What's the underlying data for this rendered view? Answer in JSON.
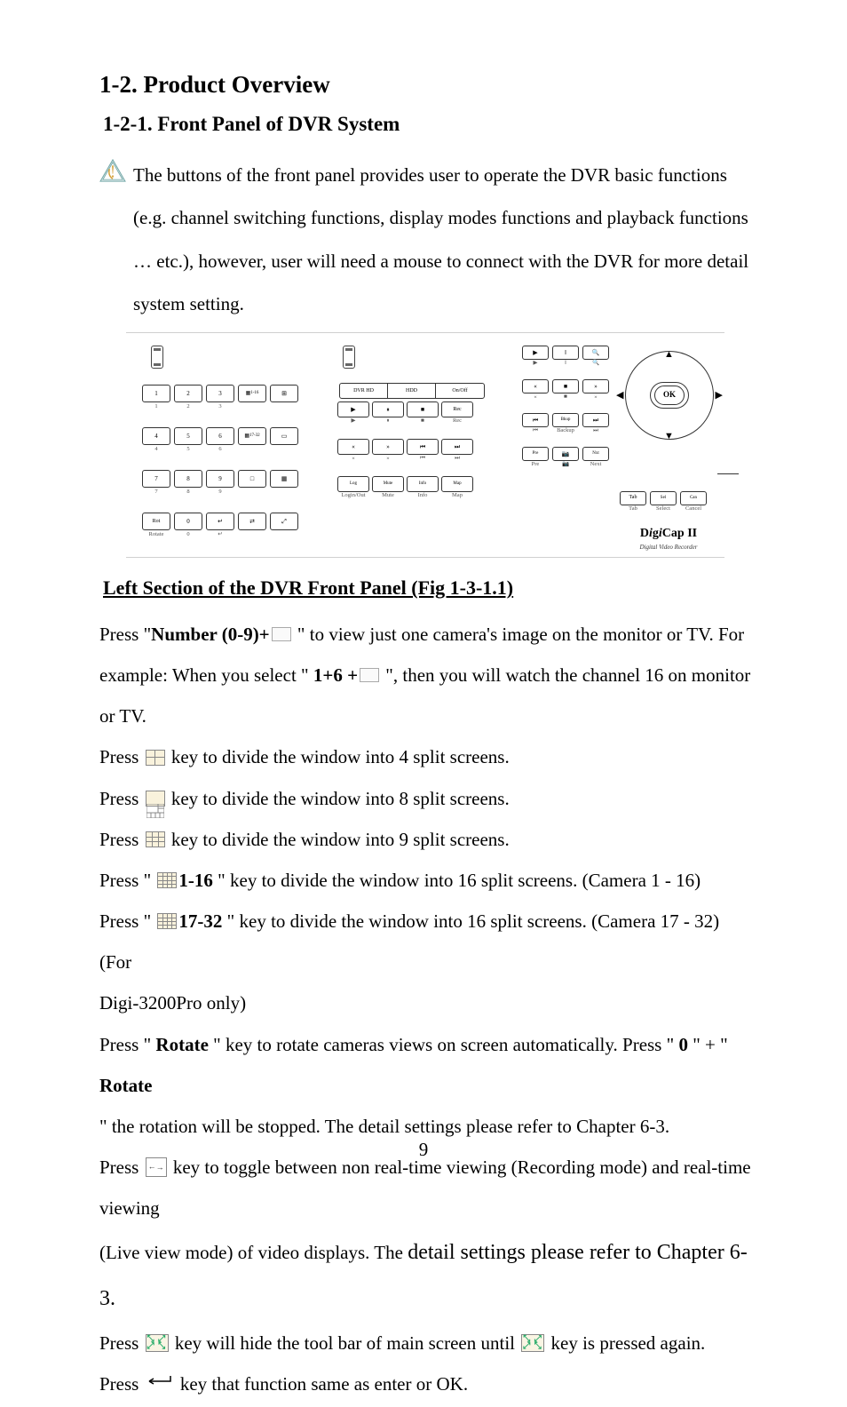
{
  "h2": "1-2.  Product Overview",
  "h3": "1-2-1.   Front Panel of DVR System",
  "intro": "The buttons of the front panel provides user to operate the DVR basic functions (e.g. channel switching functions, display modes functions and playback functions … etc.), however, user will need a mouse to connect with the DVR for more detail system setting.",
  "figure": {
    "left_btns": [
      "1",
      "2",
      "3",
      "",
      "",
      "4",
      "5",
      "6",
      "",
      "",
      "7",
      "8",
      "9",
      "",
      "",
      "Rotate",
      "0",
      "↵",
      "",
      ""
    ],
    "left_icons_row1": [
      "▦ 1-16",
      "⊞"
    ],
    "left_icons_row2": [
      "▦17-32",
      "▭"
    ],
    "left_icons_row3": [
      "□",
      "▦"
    ],
    "left_icons_row4": [
      "⇄",
      "⤢"
    ],
    "left_lbls": [
      "Rotate",
      "0",
      "",
      "",
      ""
    ],
    "mid_top": [
      "DVR HD",
      "HDD",
      "On/Off"
    ],
    "mid_btns": [
      "▶",
      "⏸",
      "■",
      "Rec",
      "«",
      "»",
      "⏮",
      "⏭",
      "Login/Out",
      "Mute",
      "Info",
      "Map"
    ],
    "r_top_btns": [
      "▶",
      "‖",
      "🔍",
      "«",
      "■",
      "»",
      "⏮",
      "Backup",
      "⏭",
      "Pre",
      "📷",
      "Next"
    ],
    "r_bottom": [
      "Tab",
      "Select",
      "Cancel"
    ],
    "ok": "OK",
    "brand_html": "DigiCap II",
    "brand1": "D",
    "brand2": "i",
    "brand3": "g",
    "brand4": "i",
    "brand5": "Cap II",
    "brand_sub": "Digital Video Recorder",
    "arrows": [
      "▲",
      "▼",
      "◀",
      "▶"
    ]
  },
  "subsec": "Left Section of the DVR Front Panel (Fig 1-3-1.1)",
  "body": {
    "p1a": "Press \"",
    "p1b": "Number (0-9)+",
    "p1c": "  \" to view just one camera's image on the monitor or TV.    For",
    "p2a": "example:    When you select \" ",
    "p2b": "1+6 +",
    "p2c": "  \", then you will watch the channel 16 on monitor or TV.",
    "p3a": "Press  ",
    "p3b": "  key to divide the window into 4 split screens.",
    "p4a": "Press  ",
    "p4b": "  key to divide the window into 8 split screens.",
    "p5a": "Press  ",
    "p5b": "  key to divide the window into 9 split screens.",
    "p6a": "Press \" ",
    "p6b": "1-16",
    "p6c": " \" key to divide the window into 16 split screens. (Camera 1 - 16)",
    "p7a": "Press \" ",
    "p7b": "17-32",
    "p7c": " \" key to divide the window into 16 split screens. (Camera 17 - 32) (For",
    "p8": "Digi-3200Pro only)",
    "p9a": "Press \" ",
    "p9b": "Rotate",
    "p9c": " \" key to rotate cameras views on screen automatically.    Press \" ",
    "p9d": "0",
    "p9e": " \" + \" ",
    "p9f": "Rotate",
    "p10": "\" the rotation will be stopped. The detail settings please refer to Chapter 6-3.",
    "p11a": "Press  ",
    "p11b": "  key to toggle between non real-time viewing (Recording mode) and real-time viewing",
    "p12a": "(Live view mode) of video displays. The ",
    "p12b": "detail settings please refer to Chapter 6-3.",
    "p13a": "Press  ",
    "p13b": "  key will hide the tool bar of main screen until  ",
    "p13c": "  key is pressed again.",
    "p14a": "Press  ",
    "p14b": "  key that function same as enter or OK."
  },
  "page_num": "9"
}
